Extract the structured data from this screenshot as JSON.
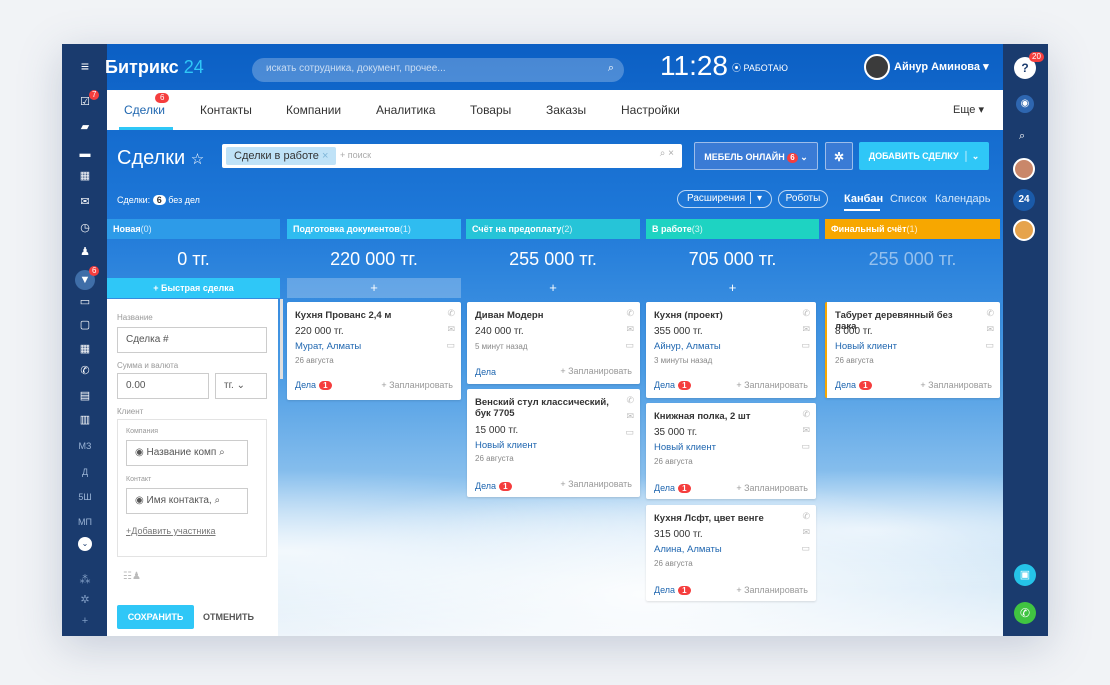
{
  "app": {
    "title_main": "Битрикс",
    "title_num": "24",
    "search_placeholder": "искать сотрудника, документ, прочее...",
    "clock": "11:28",
    "work_status": "⦿ РАБОТАЮ",
    "user_name": "Айнур Аминова"
  },
  "left_badges": {
    "tasks": "7",
    "deals": "6"
  },
  "left_texts": [
    "МЗ",
    "Д",
    "5Ш",
    "МП"
  ],
  "right_badges": {
    "help": "20"
  },
  "tabs": [
    {
      "label": "Сделки",
      "badge": "6"
    },
    {
      "label": "Контакты"
    },
    {
      "label": "Компании"
    },
    {
      "label": "Аналитика"
    },
    {
      "label": "Товары"
    },
    {
      "label": "Заказы"
    },
    {
      "label": "Настройки"
    }
  ],
  "more_label": "Еще",
  "page_title": "Сделки",
  "filter": {
    "chip": "Сделки в работе",
    "placeholder": "+ поиск"
  },
  "buttons": {
    "furniture": "МЕБЕЛЬ ОНЛАЙН",
    "furniture_badge": "6",
    "add_deal": "ДОБАВИТЬ СДЕЛКУ",
    "extensions": "Расширения",
    "robots": "Роботы"
  },
  "deals_info": {
    "prefix": "Сделки:",
    "count": "6",
    "suffix": "без дел"
  },
  "views": [
    "Канбан",
    "Список",
    "Календарь"
  ],
  "columns": [
    {
      "name": "Новая",
      "count": "(0)",
      "sum": "0 тг.",
      "color": "#2d9be8"
    },
    {
      "name": "Подготовка документов",
      "count": "(1)",
      "sum": "220 000 тг.",
      "color": "#2fbcf0"
    },
    {
      "name": "Счёт на предоплату",
      "count": "(2)",
      "sum": "255 000 тг.",
      "color": "#26c4d8"
    },
    {
      "name": "В работе",
      "count": "(3)",
      "sum": "705 000 тг.",
      "color": "#1ed3c2"
    },
    {
      "name": "Финальный счёт",
      "count": "(1)",
      "sum": "255 000 тг.",
      "color": "#f7a700"
    }
  ],
  "quick_deal": "+ Быстрая сделка",
  "form": {
    "name_label": "Название",
    "name_value": "Сделка #",
    "sum_label": "Сумма и валюта",
    "sum_value": "0.00",
    "currency": "тг.",
    "client_label": "Клиент",
    "company_label": "Компания",
    "company_placeholder": "Название комп",
    "contact_label": "Контакт",
    "contact_placeholder": "Имя контакта,",
    "add_participant": "+Добавить участника",
    "save": "СОХРАНИТЬ",
    "cancel": "ОТМЕНИТЬ"
  },
  "cards": {
    "c1": {
      "title": "Кухня Прованс 2,4 м",
      "price": "220 000 тг.",
      "link": "Мурат, Алматы",
      "date": "26 августа",
      "deals": "Дела",
      "badge": "1",
      "plan": "+ Запланировать"
    },
    "c2": {
      "title": "Диван Модерн",
      "price": "240 000 тг.",
      "date": "5 минут назад",
      "deals": "Дела",
      "plan": "+ Запланировать"
    },
    "c3": {
      "title": "Венский стул классический, бук 7705",
      "price": "15 000 тг.",
      "link": "Новый клиент",
      "date": "26 августа",
      "deals": "Дела",
      "badge": "1",
      "plan": "+ Запланировать"
    },
    "c4": {
      "title": "Кухня (проект)",
      "price": "355 000 тг.",
      "link": "Айнур, Алматы",
      "date": "3 минуты назад",
      "deals": "Дела",
      "badge": "1",
      "plan": "+ Запланировать"
    },
    "c5": {
      "title": "Книжная полка, 2 шт",
      "price": "35 000 тг.",
      "link": "Новый клиент",
      "date": "26 августа",
      "deals": "Дела",
      "badge": "1",
      "plan": "+ Запланировать"
    },
    "c6": {
      "title": "Кухня Лсфт, цвет венге",
      "price": "315 000 тг.",
      "link": "Алина, Алматы",
      "date": "26 августа",
      "deals": "Дела",
      "badge": "1",
      "plan": "+ Запланировать"
    },
    "c7": {
      "title": "Табурет деревянный без лака",
      "price": "8 000 тг.",
      "link": "Новый клиент",
      "date": "26 августа",
      "deals": "Дела",
      "badge": "1",
      "plan": "+ Запланировать"
    }
  }
}
